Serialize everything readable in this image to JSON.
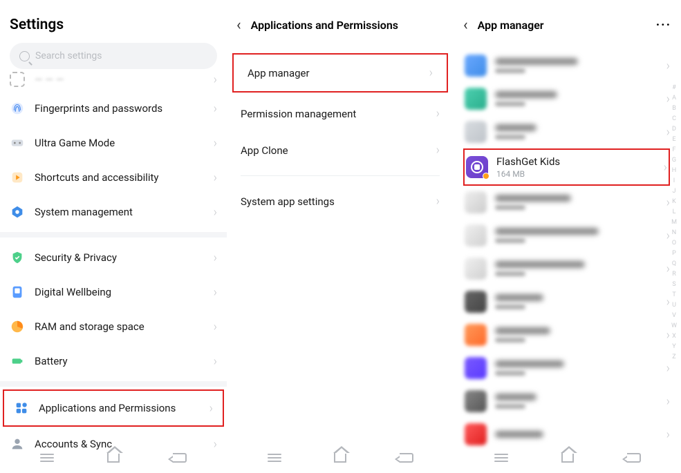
{
  "screen1": {
    "title": "Settings",
    "search_placeholder": "Search settings",
    "truncated_item_visible_label": "",
    "items": [
      {
        "label": "Fingerprints and passwords",
        "icon": "fingerprint"
      },
      {
        "label": "Ultra Game Mode",
        "icon": "game"
      },
      {
        "label": "Shortcuts and accessibility",
        "icon": "shortcuts"
      },
      {
        "label": "System management",
        "icon": "system"
      }
    ],
    "items2": [
      {
        "label": "Security & Privacy",
        "icon": "security"
      },
      {
        "label": "Digital Wellbeing",
        "icon": "wellbeing"
      },
      {
        "label": "RAM and storage space",
        "icon": "ram"
      },
      {
        "label": "Battery",
        "icon": "battery"
      }
    ],
    "items3": [
      {
        "label": "Applications and Permissions",
        "icon": "apps",
        "highlighted": true
      },
      {
        "label": "Accounts & Sync",
        "icon": "accounts"
      }
    ]
  },
  "screen2": {
    "title": "Applications and Permissions",
    "items": [
      {
        "label": "App manager",
        "highlighted": true
      },
      {
        "label": "Permission management"
      },
      {
        "label": "App Clone"
      }
    ],
    "items2": [
      {
        "label": "System app settings"
      }
    ]
  },
  "screen3": {
    "title": "App manager",
    "more_label": "···",
    "highlighted_app": {
      "name": "FlashGet Kids",
      "size": "164 MB"
    },
    "alpha": [
      "#",
      "A",
      "B",
      "C",
      "D",
      "E",
      "F",
      "G",
      "H",
      "I",
      "J",
      "K",
      "L",
      "M",
      "N",
      "O",
      "P",
      "Q",
      "R",
      "S",
      "T",
      "U",
      "V",
      "W",
      "X",
      "Y",
      "Z"
    ]
  },
  "nav": {
    "menu": "menu",
    "home": "home",
    "back": "back"
  }
}
